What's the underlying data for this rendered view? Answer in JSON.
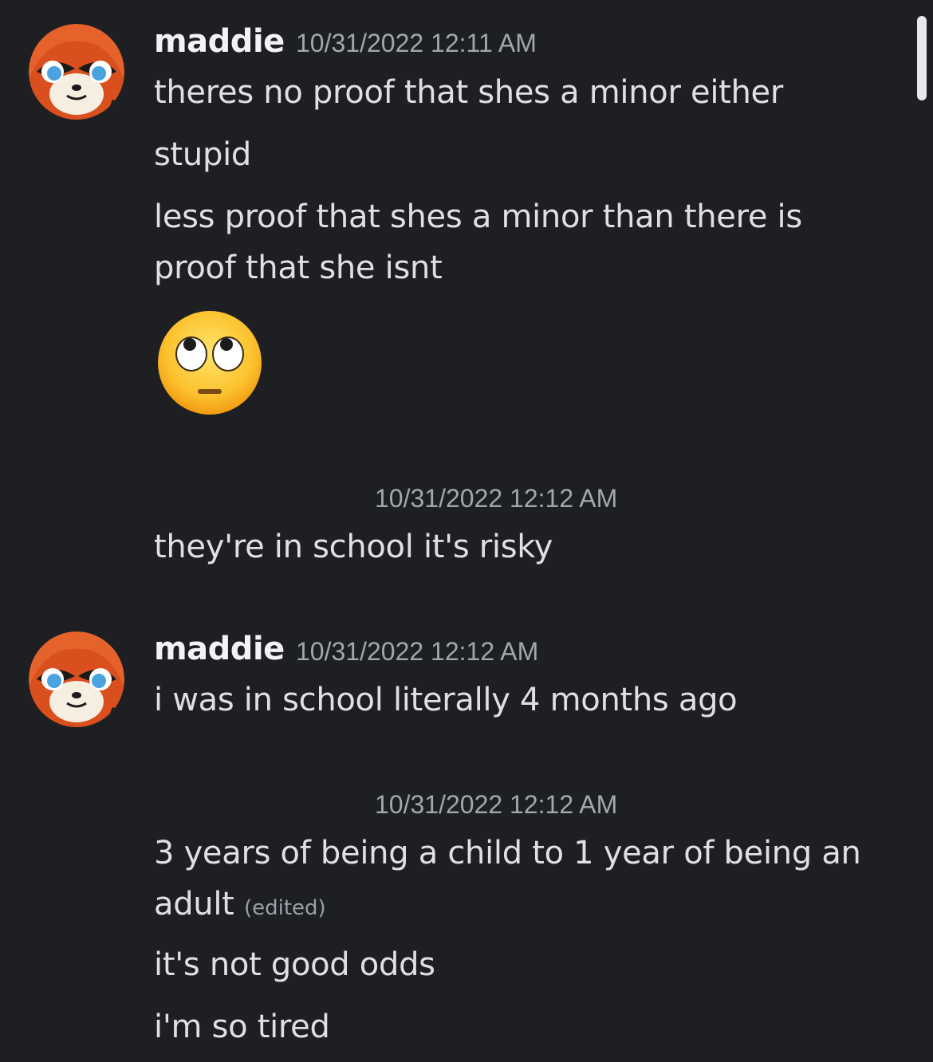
{
  "messages": {
    "group1": {
      "username": "maddie",
      "timestamp": "10/31/2022 12:11 AM",
      "lines": [
        "theres no proof that shes a minor either",
        "stupid",
        "less proof that shes a minor than there is",
        "proof that she isnt"
      ],
      "emoji": "face-with-rolling-eyes-icon"
    },
    "group2": {
      "timestamp": "10/31/2022 12:12 AM",
      "lines": [
        "they're in school it's risky"
      ]
    },
    "group3": {
      "username": "maddie",
      "timestamp": "10/31/2022 12:12 AM",
      "lines": [
        "i was in school literally 4 months ago"
      ]
    },
    "group4": {
      "timestamp": "10/31/2022 12:12 AM",
      "lines": [
        "3 years of being a child to 1 year of being an",
        "adult",
        "it's not good odds",
        "i'm so tired"
      ],
      "edited_label": "(edited)"
    }
  },
  "colors": {
    "background": "#1e1f23",
    "username": "#f2f3f5",
    "text": "#dfe0e4",
    "timestamp": "#a3a6ae"
  }
}
